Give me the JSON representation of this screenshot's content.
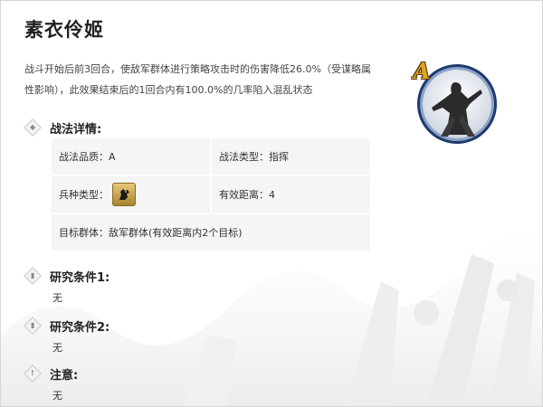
{
  "skill": {
    "name": "素衣伶姬",
    "description": "战斗开始后前3回合，使敌军群体进行策略攻击时的伤害降低26.0%（受谋略属性影响），此效果结束后的1回合内有100.0%的几率陷入混乱状态",
    "grade_badge": "A"
  },
  "details": {
    "title": "战法详情:",
    "quality": "战法品质：A",
    "type": "战法类型：指挥",
    "troop_label": "兵种类型：",
    "troop_icon": "troop-horse-icon",
    "range": "有效距离：4",
    "target": "目标群体：敌军群体(有效距离内2个目标)"
  },
  "research1": {
    "title": "研究条件1:",
    "value": "无"
  },
  "research2": {
    "title": "研究条件2:",
    "value": "无"
  },
  "note": {
    "title": "注意:",
    "value": "无"
  },
  "colors": {
    "title": "#222222",
    "cell_bg": "#f5f5f5",
    "portrait_ring": "#2f4f88",
    "badge": "#d9a12a"
  }
}
